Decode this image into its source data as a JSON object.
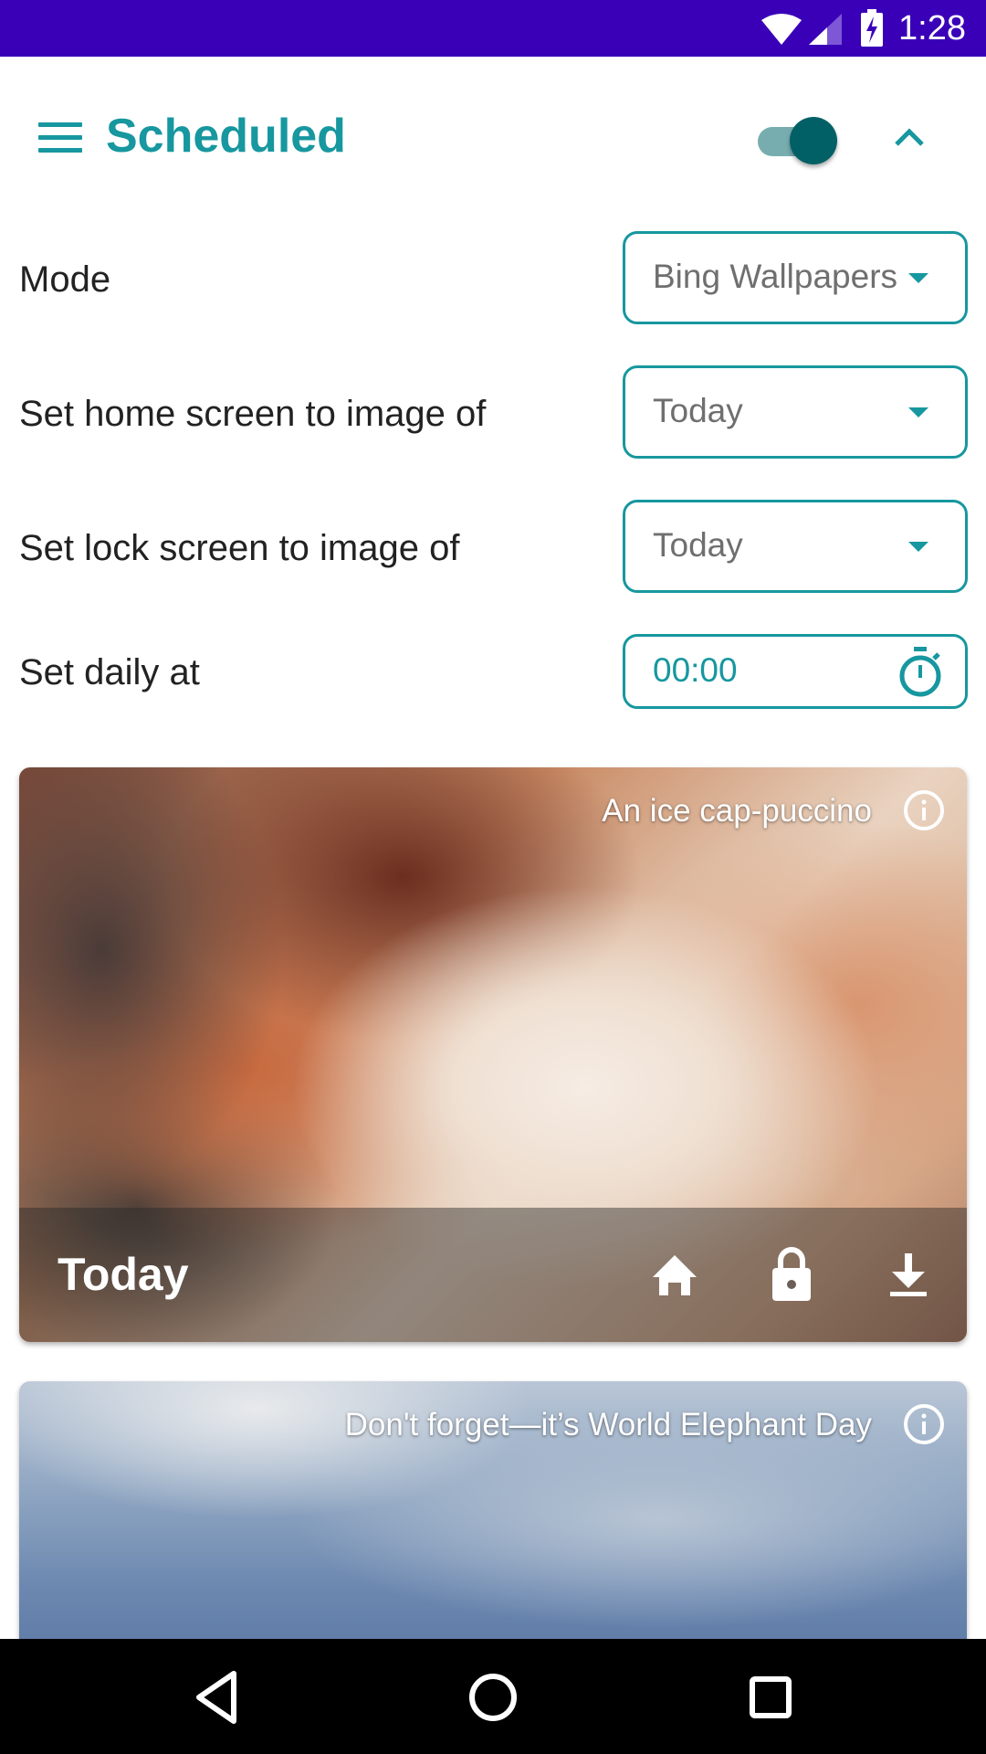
{
  "status_bar": {
    "time": "1:28",
    "icons": [
      "wifi-icon",
      "cell-signal-icon",
      "battery-charging-icon"
    ]
  },
  "header": {
    "menu_icon": "menu-icon",
    "title": "Scheduled",
    "toggle_on": true,
    "collapse_icon": "chevron-up-icon"
  },
  "settings": {
    "mode": {
      "label": "Mode",
      "value": "Bing Wallpapers"
    },
    "home_screen": {
      "label": "Set home screen to image of",
      "value": "Today"
    },
    "lock_screen": {
      "label": "Set lock screen to image of",
      "value": "Today"
    },
    "daily_time": {
      "label": "Set daily at",
      "value": "00:00",
      "icon": "timer-icon"
    }
  },
  "cards": [
    {
      "caption": "An ice cap-puccino",
      "label": "Today",
      "actions": [
        "home-icon",
        "lock-icon",
        "download-icon"
      ]
    },
    {
      "caption": "Don't forget—it’s World Elephant Day"
    }
  ],
  "nav_bar": {
    "buttons": [
      "back-icon",
      "home-circle-icon",
      "recents-icon"
    ]
  },
  "colors": {
    "status_bar": "#3a00b8",
    "accent": "#17979f",
    "toggle_thumb": "#006066",
    "toggle_track": "#78adb0"
  }
}
